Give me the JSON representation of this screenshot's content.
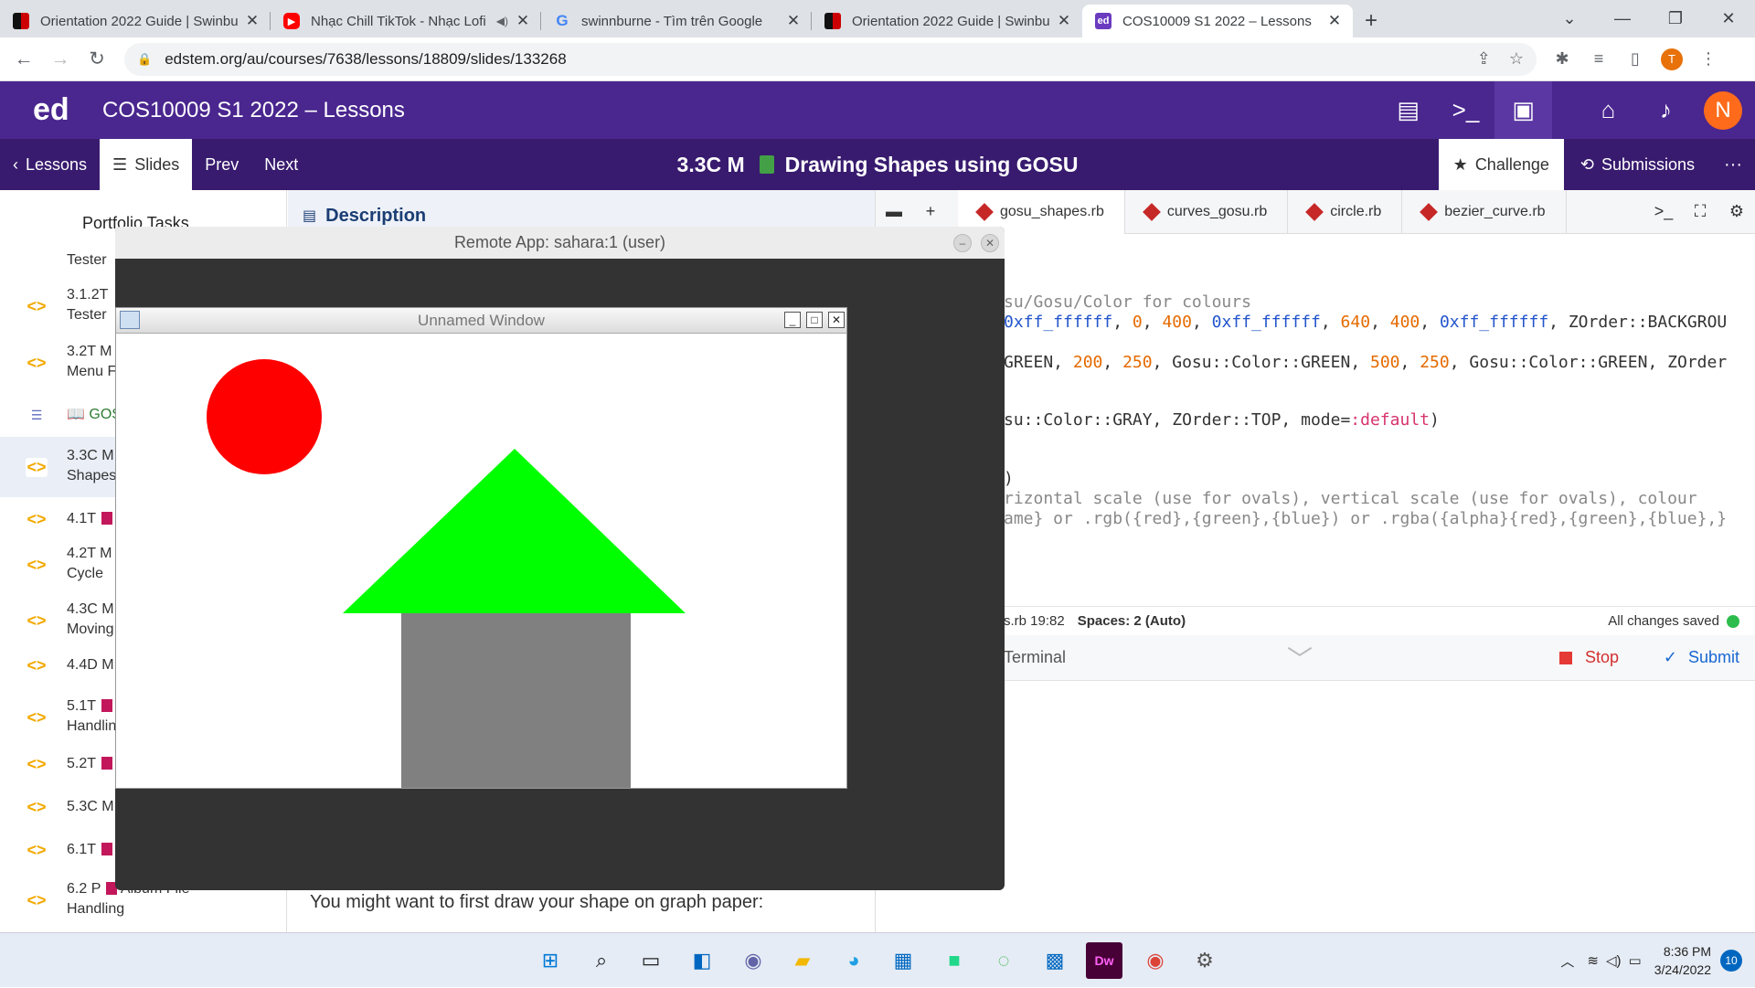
{
  "browser": {
    "tabs": [
      {
        "title": "Orientation 2022 Guide | Swinbu",
        "favicon": "swinburne-flag-icon",
        "active": false
      },
      {
        "title": "Nhạc Chill TikTok - Nhạc Lofi",
        "favicon": "youtube-icon",
        "active": false,
        "audio": true
      },
      {
        "title": "swinnburne - Tìm trên Google",
        "favicon": "google-icon",
        "active": false
      },
      {
        "title": "Orientation 2022 Guide | Swinbu",
        "favicon": "swinburne-flag-icon",
        "active": false
      },
      {
        "title": "COS10009 S1 2022 – Lessons",
        "favicon": "ed-icon",
        "active": true
      }
    ],
    "url": "edstem.org/au/courses/7638/lessons/18809/slides/133268",
    "profile_initial": "T"
  },
  "ed": {
    "logo": "ed",
    "title": "COS10009 S1 2022 – Lessons",
    "avatar_initial": "N"
  },
  "lesson_nav": {
    "lessons": "Lessons",
    "slides": "Slides",
    "prev": "Prev",
    "next": "Next",
    "slide_code": "3.3C M",
    "slide_title": "Drawing Shapes using GOSU",
    "challenge": "Challenge",
    "submissions": "Submissions"
  },
  "sidebar": {
    "header": "Portfolio Tasks",
    "items": [
      {
        "l1": "Tester",
        "l2": ""
      },
      {
        "l1": "3.1.2T",
        "l2": "Tester"
      },
      {
        "l1": "3.2T M",
        "l2": "Menu F"
      },
      {
        "l1": "GOS",
        "l2": ""
      },
      {
        "l1": "3.3C M",
        "l2": "Shapes"
      },
      {
        "l1": "4.1T",
        "l2": ""
      },
      {
        "l1": "4.2T M",
        "l2": "Cycle"
      },
      {
        "l1": "4.3C M",
        "l2": "Moving"
      },
      {
        "l1": "4.4D M",
        "l2": ""
      },
      {
        "l1": "5.1T",
        "l2": "Handlin"
      },
      {
        "l1": "5.2T",
        "l2": ""
      },
      {
        "l1": "5.3C M",
        "l2": ""
      },
      {
        "l1": "6.1T",
        "l2": ""
      },
      {
        "l1": "6.2 P",
        "l1b": "Album File",
        "l2": "Handling"
      }
    ]
  },
  "description": {
    "heading": "Description",
    "text": "You might want to first draw your shape on graph paper:"
  },
  "editor": {
    "files": [
      "gosu_shapes.rb",
      "curves_gosu.rb",
      "circle.rb",
      "bezier_curve.rb"
    ],
    "code_lines": [
      [
        {
          "t": "su/Gosu/Color for colours",
          "c": "cm"
        }
      ],
      [
        {
          "t": "0xff_ffffff",
          "c": "hx"
        },
        {
          "t": ", "
        },
        {
          "t": "0",
          "c": "num"
        },
        {
          "t": ", "
        },
        {
          "t": "400",
          "c": "num"
        },
        {
          "t": ", "
        },
        {
          "t": "0xff_ffffff",
          "c": "hx"
        },
        {
          "t": ", "
        },
        {
          "t": "640",
          "c": "num"
        },
        {
          "t": ", "
        },
        {
          "t": "400",
          "c": "num"
        },
        {
          "t": ", "
        },
        {
          "t": "0xff_ffffff",
          "c": "hx"
        },
        {
          "t": ", ZOrder::BACKGROU"
        }
      ],
      [
        {
          "t": "GREEN, "
        },
        {
          "t": "200",
          "c": "num"
        },
        {
          "t": ", "
        },
        {
          "t": "250",
          "c": "num"
        },
        {
          "t": ", Gosu::Color::GREEN, "
        },
        {
          "t": "500",
          "c": "num"
        },
        {
          "t": ", "
        },
        {
          "t": "250",
          "c": "num"
        },
        {
          "t": ", Gosu::Color::GREEN, ZOrder"
        }
      ],
      [
        {
          "t": "su::Color::GRAY, ZOrder::TOP, mode="
        },
        {
          "t": ":default",
          "c": "sym"
        },
        {
          "t": ")"
        }
      ],
      [
        {
          "t": ")"
        }
      ],
      [
        {
          "t": "rizontal scale (use for ovals), vertical scale (use for ovals), colour",
          "c": "cm"
        }
      ],
      [
        {
          "t": "ame} or .rgb({red},{green},{blue}) or .rgba({alpha}{red},{green},{blue},}",
          "c": "cm"
        }
      ]
    ],
    "status_file": "s.rb 19:82",
    "spaces": "Spaces: 2 (Auto)",
    "saved": "All changes saved",
    "terminal": "Terminal",
    "stop": "Stop",
    "submit": "Submit"
  },
  "remote_app": {
    "title": "Remote App: sahara:1 (user)",
    "window_title": "Unnamed Window"
  },
  "taskbar": {
    "time": "8:36 PM",
    "date": "3/24/2022",
    "notifications": "10"
  },
  "colors": {
    "ed_purple": "#4a268f",
    "nav_purple": "#381b6e",
    "circle": "#ff0000",
    "roof": "#00ff00",
    "wall": "#808080"
  }
}
